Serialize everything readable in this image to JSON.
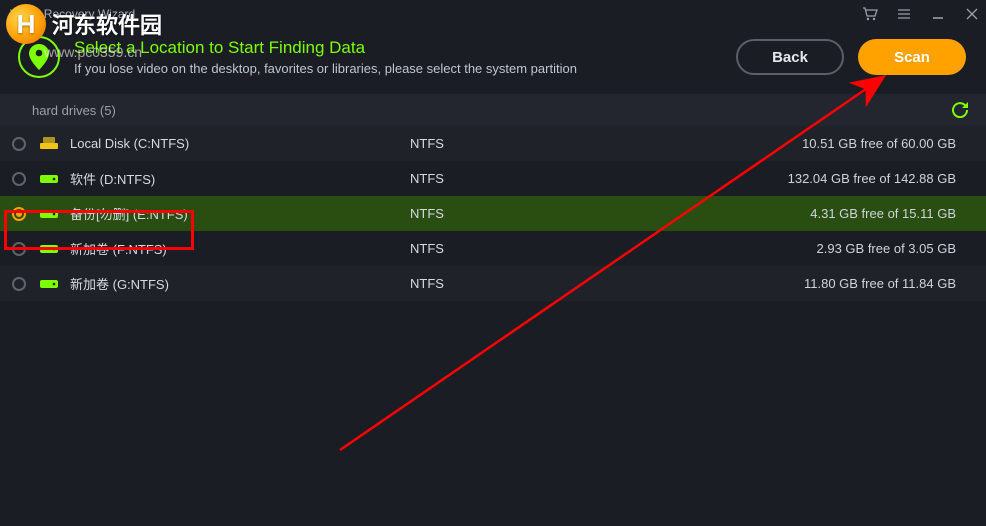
{
  "titlebar": {
    "title": "Video Recovery Wizard"
  },
  "header": {
    "heading": "Select a Location to Start Finding Data",
    "subtitle": "If you lose video on the desktop, favorites or libraries, please select the system partition",
    "back_label": "Back",
    "scan_label": "Scan"
  },
  "section": {
    "label": "hard drives (5)"
  },
  "drives": [
    {
      "name": "Local Disk (C:NTFS)",
      "fs": "NTFS",
      "space": "10.51 GB free of 60.00 GB",
      "selected": false,
      "iconColor": "#f0c419",
      "iconType": "system"
    },
    {
      "name": "软件 (D:NTFS)",
      "fs": "NTFS",
      "space": "132.04 GB free of 142.88 GB",
      "selected": false,
      "iconColor": "#7cff00",
      "iconType": "hdd"
    },
    {
      "name": "备份[勿删] (E:NTFS)",
      "fs": "NTFS",
      "space": "4.31 GB free of 15.11 GB",
      "selected": true,
      "iconColor": "#7cff00",
      "iconType": "hdd"
    },
    {
      "name": "新加卷 (F:NTFS)",
      "fs": "NTFS",
      "space": "2.93 GB free of 3.05 GB",
      "selected": false,
      "iconColor": "#7cff00",
      "iconType": "hdd"
    },
    {
      "name": "新加卷 (G:NTFS)",
      "fs": "NTFS",
      "space": "11.80 GB free of 11.84 GB",
      "selected": false,
      "iconColor": "#7cff00",
      "iconType": "hdd"
    }
  ],
  "watermark": {
    "brand": "河东软件园",
    "url": "www.pc0359.cn",
    "logo_letter": "H"
  },
  "colors": {
    "accent": "#7cff00",
    "primary": "#ffa200",
    "annotation": "#ff0000"
  }
}
